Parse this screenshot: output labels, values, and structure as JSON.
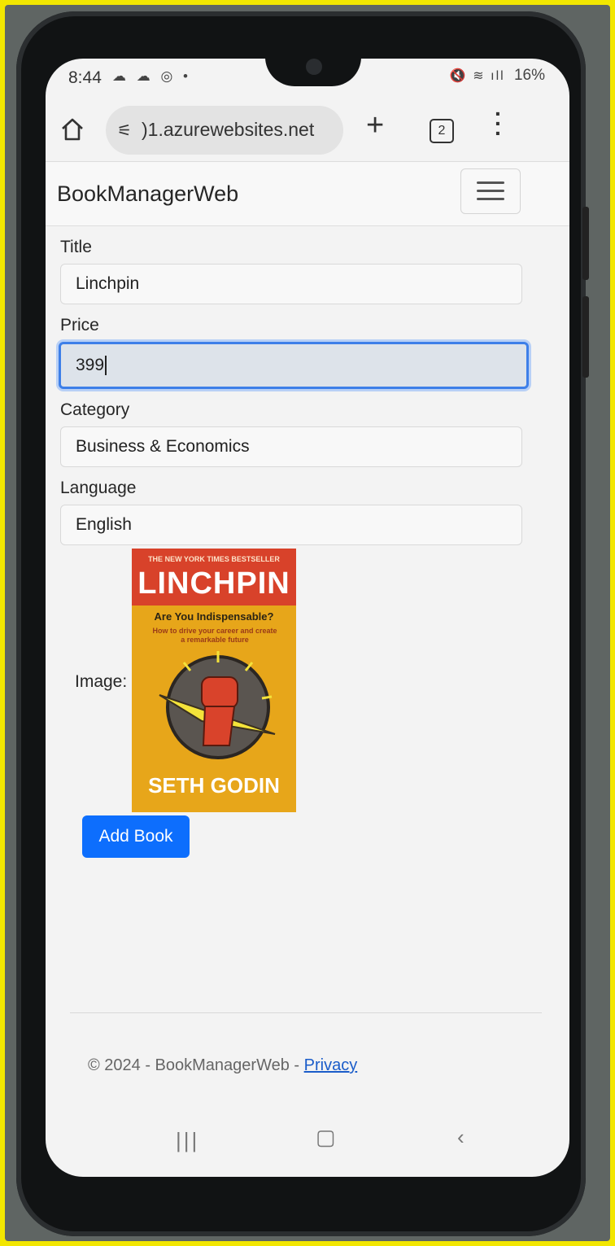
{
  "status_bar": {
    "time": "8:44",
    "left_icons": "☁ ☁ ◎ •",
    "signal": "🔇 ≋ ıll",
    "battery": "16%"
  },
  "browser": {
    "url": ")1.azurewebsites.net",
    "tab_count": "2",
    "plus_label": "+"
  },
  "navbar": {
    "brand": "BookManagerWeb"
  },
  "form": {
    "title_label": "Title",
    "title_value": "Linchpin",
    "price_label": "Price",
    "price_value": "399",
    "category_label": "Category",
    "category_value": "Business & Economics",
    "language_label": "Language",
    "language_value": "English",
    "image_label": "Image:",
    "submit_label": "Add Book"
  },
  "cover": {
    "tagline": "THE NEW YORK TIMES BESTSELLER",
    "title": "LINCHPIN",
    "subtitle": "Are You Indispensable?",
    "subline": "How to drive your career and create a remarkable future",
    "author": "SETH GODIN"
  },
  "footer": {
    "text": "© 2024 - BookManagerWeb - ",
    "privacy_link": "Privacy"
  },
  "colors": {
    "primary_button": "#0d6efd",
    "focus_border": "#3d7fe8",
    "frame": "#f2e600",
    "cover_red": "#d8422a",
    "cover_yellow": "#e7a61a"
  }
}
